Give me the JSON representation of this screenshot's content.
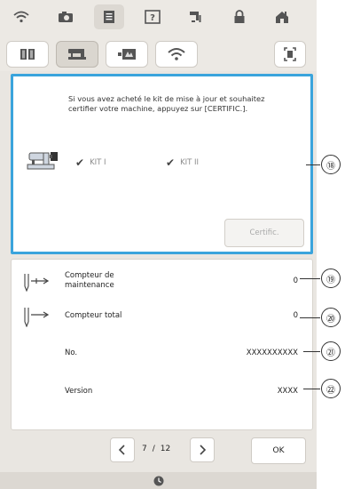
{
  "top_bar": {
    "icons": [
      "wifi-icon",
      "camera-icon",
      "document-icon",
      "help-icon",
      "needle-settings-icon",
      "lock-icon",
      "home-icon"
    ],
    "selected": "document-icon"
  },
  "tab_bar": {
    "tabs": [
      "book-icon",
      "machine-icon",
      "embroidery-icon",
      "wifi-icon"
    ],
    "selected": "machine-icon",
    "right_icon": "fullscreen-icon"
  },
  "certification": {
    "message": "Si vous avez acheté le kit de mise à jour et souhaitez certifier votre machine, appuyez sur [CERTIFIC.].",
    "kit1_label": "KIT I",
    "kit2_label": "KIT II",
    "certif_button": "Certific."
  },
  "info": {
    "rows": [
      {
        "label": "Compteur de maintenance",
        "value": "0"
      },
      {
        "label": "Compteur total",
        "value": "0"
      },
      {
        "label": "No.",
        "value": "XXXXXXXXXX"
      },
      {
        "label": "Version",
        "value": "XXXX"
      }
    ]
  },
  "nav": {
    "page_current": "7",
    "page_sep": "/",
    "page_total": "12",
    "ok_label": "OK"
  },
  "callouts": [
    "⑱",
    "⑲",
    "⑳",
    "㉑",
    "㉒"
  ],
  "colors": {
    "accent_border": "#3aa4dc",
    "background": "#e9e6e1"
  }
}
